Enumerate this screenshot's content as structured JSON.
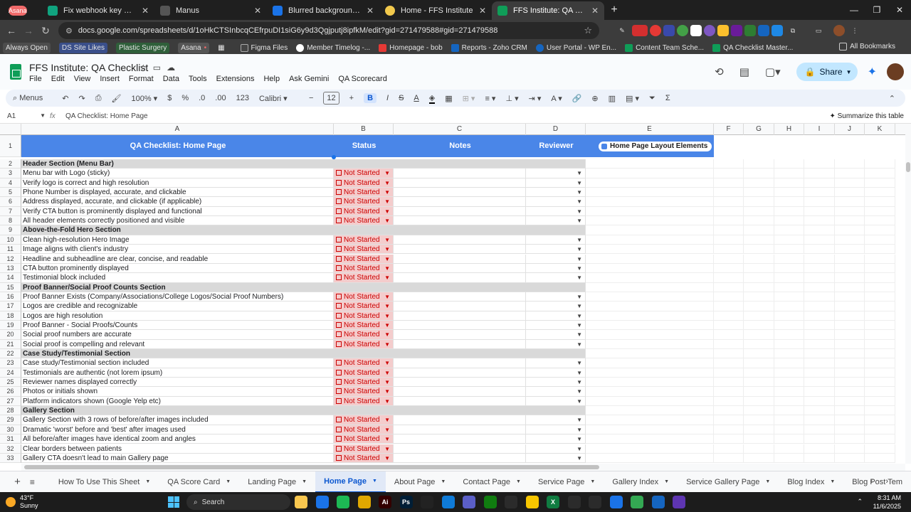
{
  "browser": {
    "tabs": [
      {
        "title": "Asana",
        "badge": "",
        "color": "#f06a6a"
      },
      {
        "title": "Fix webhook key mismatch",
        "color": "#10a37f"
      },
      {
        "title": "Manus",
        "color": "#555555"
      },
      {
        "title": "Blurred background vectors, ph",
        "color": "#1a73e8"
      },
      {
        "title": "Home - FFS Institute",
        "color": "#f2c94c"
      },
      {
        "title": "FFS Institute: QA Checklist - Go",
        "color": "#0f9d58",
        "active": true
      }
    ],
    "new_tab": "+",
    "url": "docs.google.com/spreadsheets/d/1oHkCTSInbcqCEfrpuDI1siG6y9d3Qgjputj8ipfkM/edit?gid=271479588#gid=271479588",
    "bookmarks": [
      {
        "label": "Always Open",
        "color": "#5f6368",
        "pill": true
      },
      {
        "label": "DS Site Likes",
        "color": "#5f6368",
        "pill": true
      },
      {
        "label": "Plastic Surgery",
        "color": "#5f6368",
        "pill": true
      },
      {
        "label": "Asana",
        "color": "#5f6368",
        "pill": true
      },
      {
        "label": "",
        "color": "#3c3c3c"
      },
      {
        "label": "Figma Files",
        "color": "#a259ff"
      },
      {
        "label": "Member Timelog -...",
        "color": "#ffffff"
      },
      {
        "label": "Homepage - bob",
        "color": "#e53935"
      },
      {
        "label": "Reports - Zoho CRM",
        "color": "#1565c0"
      },
      {
        "label": "User Portal - WP En...",
        "color": "#1565c0"
      },
      {
        "label": "Content Team Sche...",
        "color": "#0f9d58"
      },
      {
        "label": "QA Checklist Master...",
        "color": "#0f9d58"
      }
    ],
    "all_bookmarks": "All Bookmarks"
  },
  "sheets": {
    "title": "FFS Institute: QA Checklist",
    "menu": [
      "File",
      "Edit",
      "View",
      "Insert",
      "Format",
      "Data",
      "Tools",
      "Extensions",
      "Help",
      "Ask Gemini",
      "QA Scorecard"
    ],
    "share_label": "Share",
    "toolbar": {
      "menus": "Menus",
      "zoom": "100%",
      "currency": "$",
      "percent": "%",
      "dec_less": ".0",
      "dec_more": ".00",
      "num_format": "123",
      "font": "Calibri",
      "font_size": "12",
      "bold": "B",
      "italic": "I",
      "strike": "S",
      "text_color": "A"
    },
    "namebox": "A1",
    "formula": "QA Checklist: Home Page",
    "summarize": "Summarize this table"
  },
  "grid": {
    "columns": [
      "A",
      "B",
      "C",
      "D",
      "E",
      "F",
      "G",
      "H",
      "I",
      "J",
      "K"
    ],
    "header_row": {
      "a": "QA Checklist: Home Page",
      "b": "Status",
      "c": "Notes",
      "d": "Reviewer",
      "e": "Home Page Layout Elements"
    },
    "status_value": "Not Started",
    "rows": [
      {
        "n": "2",
        "text": "Header Section (Menu Bar)",
        "section": true
      },
      {
        "n": "3",
        "text": "Menu bar with Logo (sticky)"
      },
      {
        "n": "4",
        "text": "Verify logo is correct and high resolution"
      },
      {
        "n": "5",
        "text": "Phone Number is displayed, accurate, and clickable"
      },
      {
        "n": "6",
        "text": "Address displayed, accurate, and clickable (if applicable)"
      },
      {
        "n": "7",
        "text": "Verify CTA button is prominently displayed and functional"
      },
      {
        "n": "8",
        "text": "All header elements correctly positioned and visible"
      },
      {
        "n": "9",
        "text": "Above-the-Fold Hero Section",
        "section": true
      },
      {
        "n": "10",
        "text": "Clean high-resolution Hero Image"
      },
      {
        "n": "11",
        "text": "Image aligns with client's industry"
      },
      {
        "n": "12",
        "text": "Headline and subheadline are clear, concise, and readable"
      },
      {
        "n": "13",
        "text": "CTA button prominently displayed"
      },
      {
        "n": "14",
        "text": "Testimonial block included"
      },
      {
        "n": "15",
        "text": "Proof Banner/Social Proof Counts Section",
        "section": true
      },
      {
        "n": "16",
        "text": "Proof Banner Exists (Company/Associations/College Logos/Social Proof Numbers)"
      },
      {
        "n": "17",
        "text": "Logos are credible and recognizable"
      },
      {
        "n": "18",
        "text": "Logos are high resolution"
      },
      {
        "n": "19",
        "text": "Proof Banner - Social Proofs/Counts"
      },
      {
        "n": "20",
        "text": "Social proof numbers are accurate"
      },
      {
        "n": "21",
        "text": "Social proof is compelling and relevant"
      },
      {
        "n": "22",
        "text": "Case Study/Testimonial Section",
        "section": true
      },
      {
        "n": "23",
        "text": "Case study/Testimonial section included"
      },
      {
        "n": "24",
        "text": "Testimonials are authentic (not lorem ipsum)"
      },
      {
        "n": "25",
        "text": "Reviewer names displayed correctly"
      },
      {
        "n": "26",
        "text": "Photos or initials shown"
      },
      {
        "n": "27",
        "text": "Platform indicators shown (Google Yelp etc)"
      },
      {
        "n": "28",
        "text": "Gallery Section",
        "section": true
      },
      {
        "n": "29",
        "text": "Gallery Section with 3 rows of before/after images included"
      },
      {
        "n": "30",
        "text": "Dramatic 'worst' before and 'best' after images used"
      },
      {
        "n": "31",
        "text": "All before/after images have identical zoom and angles"
      },
      {
        "n": "32",
        "text": "Clear borders between patients"
      },
      {
        "n": "33",
        "text": "Gallery CTA doesn't lead to main Gallery page"
      }
    ]
  },
  "sheet_tabs": [
    "How To Use This Sheet",
    "QA Score Card",
    "Landing Page",
    "Home Page",
    "About Page",
    "Contact Page",
    "Service Page",
    "Gallery Index",
    "Service Gallery Page",
    "Blog Index",
    "Blog Post Tem"
  ],
  "active_sheet": "Home Page",
  "taskbar": {
    "temp": "43°F",
    "weather": "Sunny",
    "search": "Search",
    "time": "8:31 AM",
    "date": "11/6/2025",
    "apps": [
      {
        "name": "file-explorer",
        "color": "#f9c74f",
        "glyph": ""
      },
      {
        "name": "chrome",
        "color": "#1a73e8",
        "glyph": ""
      },
      {
        "name": "spotify",
        "color": "#1db954",
        "glyph": ""
      },
      {
        "name": "folder",
        "color": "#e0a800",
        "glyph": ""
      },
      {
        "name": "illustrator",
        "color": "#330000",
        "glyph": "Ai"
      },
      {
        "name": "photoshop",
        "color": "#001e36",
        "glyph": "Ps"
      },
      {
        "name": "capcut",
        "color": "#222222",
        "glyph": ""
      },
      {
        "name": "edge",
        "color": "#0f7bd8",
        "glyph": ""
      },
      {
        "name": "teams",
        "color": "#5b5fc7",
        "glyph": ""
      },
      {
        "name": "xbox",
        "color": "#107c10",
        "glyph": ""
      },
      {
        "name": "copilot",
        "color": "#2b2b2b",
        "glyph": ""
      },
      {
        "name": "sticky-notes",
        "color": "#f7c600",
        "glyph": ""
      },
      {
        "name": "excel",
        "color": "#107c41",
        "glyph": "X"
      },
      {
        "name": "chatgpt",
        "color": "#2b2b2b",
        "glyph": ""
      },
      {
        "name": "discord",
        "color": "#2b2b2b",
        "glyph": ""
      },
      {
        "name": "chrome-active",
        "color": "#1a73e8",
        "glyph": ""
      },
      {
        "name": "chrome-2",
        "color": "#34a853",
        "glyph": ""
      },
      {
        "name": "notepad",
        "color": "#1565c0",
        "glyph": ""
      },
      {
        "name": "other",
        "color": "#5e35b1",
        "glyph": ""
      }
    ]
  }
}
